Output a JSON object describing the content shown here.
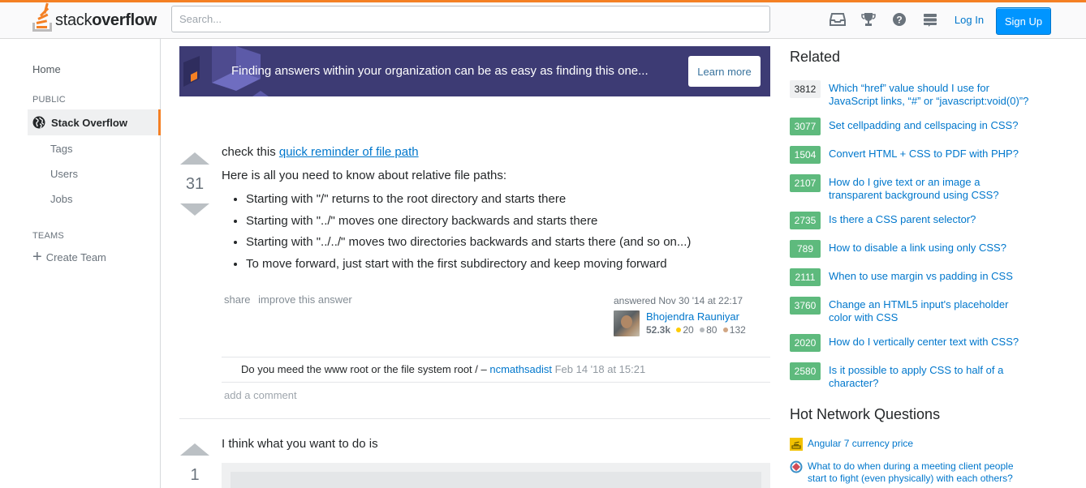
{
  "header": {
    "logo_prefix": "stack",
    "logo_bold": "overflow",
    "search_placeholder": "Search...",
    "icons": [
      "inbox-icon",
      "achievements-icon",
      "help-icon",
      "site-switcher-icon"
    ],
    "login_label": "Log In",
    "signup_label": "Sign Up"
  },
  "leftnav": {
    "home": "Home",
    "public_heading": "PUBLIC",
    "active_item": "Stack Overflow",
    "sub_items": [
      "Tags",
      "Users",
      "Jobs"
    ],
    "teams_heading": "TEAMS",
    "create_team": "Create Team"
  },
  "banner": {
    "text": "Finding answers within your organization can be as easy as finding this one...",
    "button_label": "Learn more"
  },
  "answer1": {
    "votes": "31",
    "intro_prefix": "check this ",
    "intro_link": "quick reminder of file path",
    "lead": "Here is all you need to know about relative file paths:",
    "bullets": [
      "Starting with \"/\" returns to the root directory and starts there",
      "Starting with \"../\" moves one directory backwards and starts there",
      "Starting with \"../../\" moves two directories backwards and starts there (and so on...)",
      "To move forward, just start with the first subdirectory and keep moving forward"
    ],
    "menu": [
      "share",
      "improve this answer"
    ],
    "answered": "answered Nov 30 '14 at 22:17",
    "user_name": "Bhojendra Rauniyar",
    "reputation": "52.3k",
    "gold": "20",
    "silver": "80",
    "bronze": "132",
    "comment_text": "Do you meed the www root or the file system root / – ",
    "comment_user": "ncmathsadist",
    "comment_date": "Feb 14 '18 at 15:21",
    "add_comment": "add a comment"
  },
  "answer2": {
    "votes": "1",
    "text": "I think what you want to do is"
  },
  "related": {
    "title": "Related",
    "items": [
      {
        "score": "3812",
        "accepted": false,
        "title": "Which “href” value should I use for JavaScript links, “#” or “javascript:void(0)”?"
      },
      {
        "score": "3077",
        "accepted": true,
        "title": "Set cellpadding and cellspacing in CSS?"
      },
      {
        "score": "1504",
        "accepted": true,
        "title": "Convert HTML + CSS to PDF with PHP?"
      },
      {
        "score": "2107",
        "accepted": true,
        "title": "How do I give text or an image a transparent background using CSS?"
      },
      {
        "score": "2735",
        "accepted": true,
        "title": "Is there a CSS parent selector?"
      },
      {
        "score": "789",
        "accepted": true,
        "title": "How to disable a link using only CSS?"
      },
      {
        "score": "2111",
        "accepted": true,
        "title": "When to use margin vs padding in CSS"
      },
      {
        "score": "3760",
        "accepted": true,
        "title": "Change an HTML5 input's placeholder color with CSS"
      },
      {
        "score": "2020",
        "accepted": true,
        "title": "How do I vertically center text with CSS?"
      },
      {
        "score": "2580",
        "accepted": true,
        "title": "Is it possible to apply CSS to half of a character?"
      }
    ]
  },
  "hnq": {
    "title": "Hot Network Questions",
    "items": [
      {
        "icon": "stackoverflow-site-icon",
        "title": "Angular 7 currency price"
      },
      {
        "icon": "interpersonal-site-icon",
        "title": "What to do when during a meeting client people start to fight (even physically) with each others?"
      }
    ]
  },
  "colors": {
    "brand_orange": "#f48024",
    "link_blue": "#0077cc",
    "signup_blue": "#0095ff",
    "accepted_green": "#5eba7d",
    "banner_bg": "#3d3b74"
  }
}
